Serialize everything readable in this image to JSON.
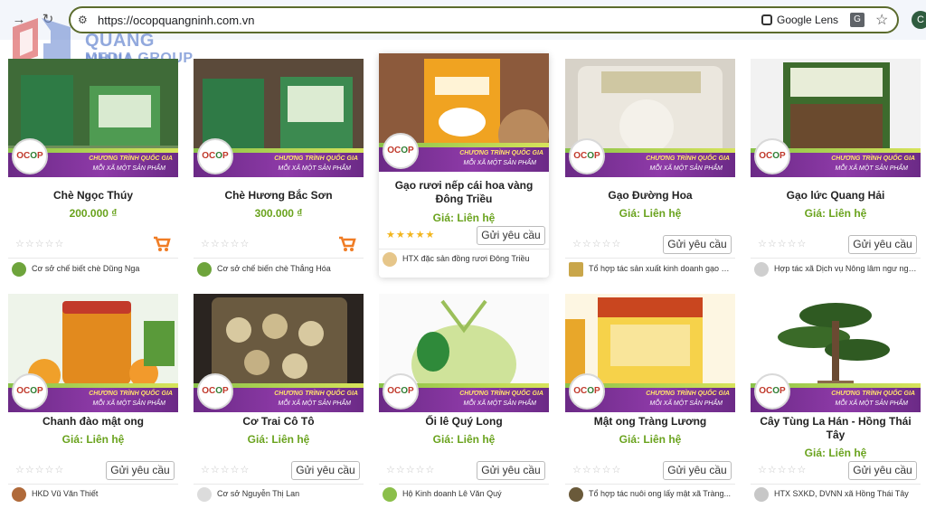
{
  "browser": {
    "url": "https://ocopquangninh.com.vn",
    "lens_label": "Google Lens",
    "translate_glyph": "G",
    "avatar_initial": "C"
  },
  "watermark": {
    "line1": "QUANG NINH",
    "line2": "MEDIA GROUP"
  },
  "ocop_banner": {
    "line1": "CHƯƠNG TRÌNH QUỐC GIA",
    "line2": "MỖI XÃ MỘT SẢN PHẨM"
  },
  "products": [
    {
      "name": "Chè Ngọc Thúy",
      "price": "200.000 ₫",
      "rating": 0,
      "action": "cart",
      "seller": "Cơ sở chế biết chè Dũng Nga"
    },
    {
      "name": "Chè Hương Bắc Sơn",
      "price": "300.000 ₫",
      "rating": 0,
      "action": "cart",
      "seller": "Cơ sở chế biến chè Thắng Hóa"
    },
    {
      "name": "Gạo rươi nếp cái hoa vàng Đông Triều",
      "price": "Giá: Liên hệ",
      "rating": 5,
      "action": "Gửi yêu cầu",
      "seller": "HTX đặc sản đồng rươi Đông Triều"
    },
    {
      "name": "Gạo Đường Hoa",
      "price": "Giá: Liên hệ",
      "rating": 0,
      "action": "Gửi yêu cầu",
      "seller": "Tổ hợp tác sản xuất kinh doanh gạo Đ..."
    },
    {
      "name": "Gạo lức Quang Hải",
      "price": "Giá: Liên hệ",
      "rating": 0,
      "action": "Gửi yêu cầu",
      "seller": "Hợp tác xã Dịch vụ Nông lâm ngư nghi..."
    },
    {
      "name": "Chanh đào mật ong",
      "price": "Giá: Liên hệ",
      "rating": 0,
      "action": "Gửi yêu cầu",
      "seller": "HKD Vũ Văn Thiết"
    },
    {
      "name": "Cơ Trai Cô Tô",
      "price": "Giá: Liên hệ",
      "rating": 0,
      "action": "Gửi yêu cầu",
      "seller": "Cơ sở Nguyễn Thị Lan"
    },
    {
      "name": "Ối lê Quý Long",
      "price": "Giá: Liên hệ",
      "rating": 0,
      "action": "Gửi yêu cầu",
      "seller": "Hộ Kinh doanh Lê Văn Quý"
    },
    {
      "name": "Mật ong Tràng Lương",
      "price": "Giá: Liên hệ",
      "rating": 0,
      "action": "Gửi yêu cầu",
      "seller": "Tổ hợp tác nuôi ong lấy mật xã Tràng..."
    },
    {
      "name": "Cây Tùng La Hán - Hồng Thái Tây",
      "price": "Giá: Liên hệ",
      "rating": 0,
      "action": "Gửi yêu cầu",
      "seller": "HTX SXKD, DVNN xã Hồng Thái Tây"
    }
  ],
  "empty_stars": "☆☆☆☆☆",
  "full_stars": "★★★★★",
  "colors": {
    "price": "#6aa31e",
    "ocop_purple": "#8e3aa8",
    "cart": "#f07c24",
    "omnibox_border": "#5b6b2d"
  }
}
